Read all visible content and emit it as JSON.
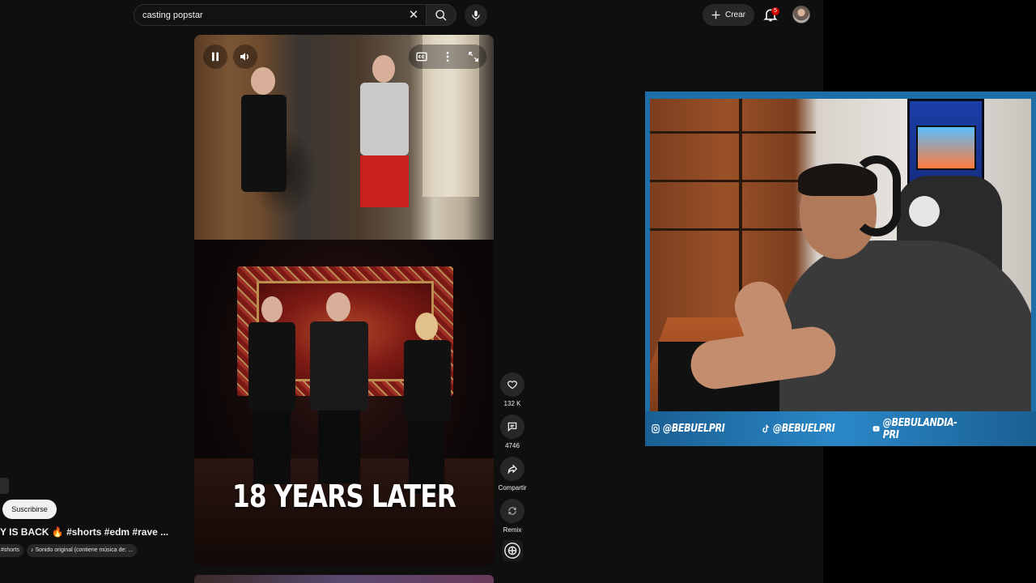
{
  "search": {
    "value": "casting popstar",
    "clear_glyph": "✕"
  },
  "header": {
    "create_label": "Crear",
    "notification_count": "5"
  },
  "short": {
    "overlay_text": "18 YEARS LATER",
    "title": "Y IS BACK 🔥 #shorts #edm #rave ...",
    "subscribe_label": "Suscribirse",
    "tags": [
      "#shorts",
      "Sonido original (contiene música de: ..."
    ],
    "sound_note": "♪"
  },
  "actions": {
    "like_count": "132 K",
    "comment_count": "4746",
    "share_label": "Compartir",
    "remix_label": "Remix"
  },
  "webcam": {
    "socials": [
      {
        "icon": "instagram-icon",
        "handle": "@BEBUELPRI"
      },
      {
        "icon": "tiktok-icon",
        "handle": "@BEBUELPRI"
      },
      {
        "icon": "youtube-icon",
        "handle": "@BEBULANDIA-PRI"
      }
    ]
  },
  "colors": {
    "yt_background": "#0f0f0f",
    "chip": "#272727",
    "webcam_bar": "#2a88c8",
    "notification_badge": "#cc0000"
  }
}
